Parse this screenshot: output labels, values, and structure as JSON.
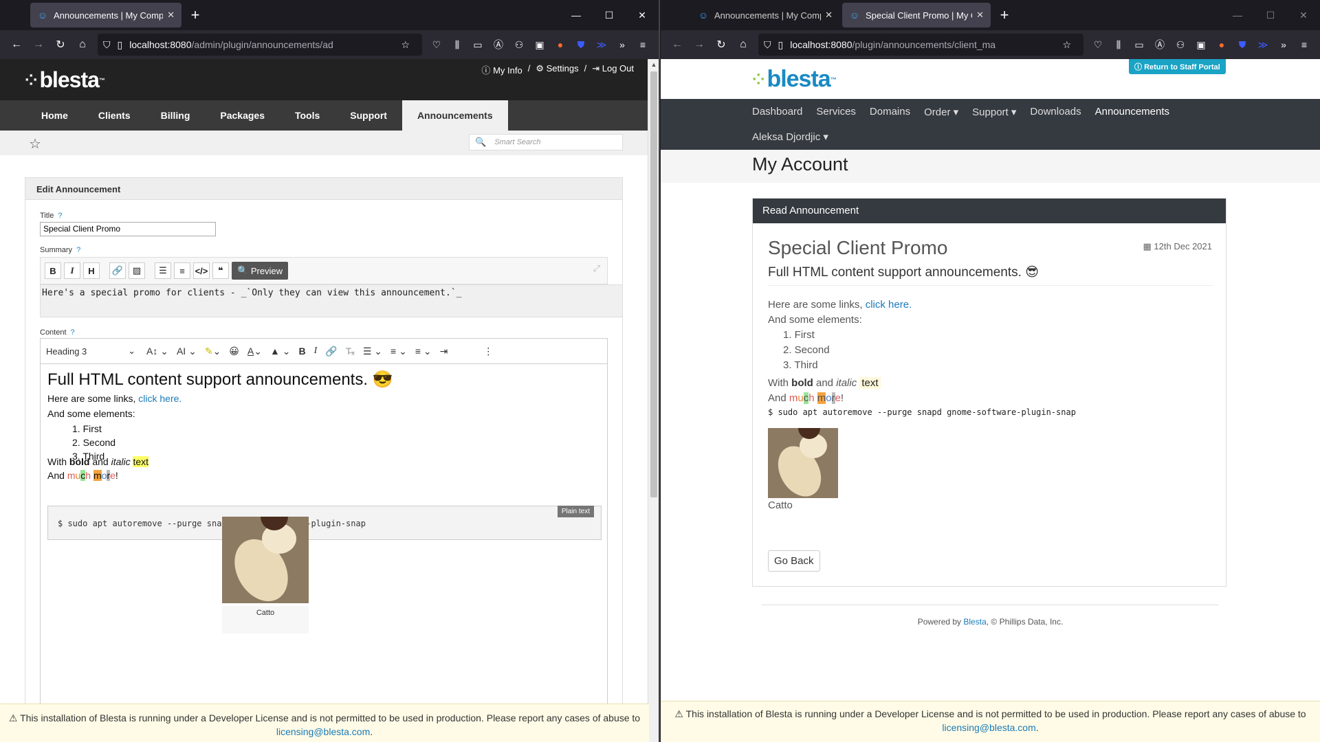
{
  "left": {
    "tabs": [
      {
        "title": "Announcements | My Company",
        "active": true
      }
    ],
    "url": {
      "host": "localhost:8080",
      "path": "/admin/plugin/announcements/ad"
    },
    "header_links": [
      "My Info",
      "Settings",
      "Log Out"
    ],
    "logo": "blesta",
    "nav": [
      "Home",
      "Clients",
      "Billing",
      "Packages",
      "Tools",
      "Support",
      "Announcements"
    ],
    "nav_active": "Announcements",
    "smart_search_placeholder": "Smart Search",
    "panel_title": "Edit Announcement",
    "title_label": "Title",
    "title_value": "Special Client Promo",
    "summary_label": "Summary",
    "preview_label": "Preview",
    "summary_value": "Here's a special promo for clients - _`Only they can view this announcement.`_",
    "content_label": "Content",
    "heading_select": "Heading 3",
    "content": {
      "h3": "Full HTML content support announcements. 😎",
      "links_text": "Here are some links, ",
      "links_link": "click here.",
      "elements_text": "And some elements:",
      "list": [
        "First",
        "Second",
        "Third"
      ],
      "with": "With ",
      "bold": "bold",
      "and": " and ",
      "italic": "italic",
      "text": "text",
      "and2": "And ",
      "much_more": "much more",
      "bang": "!",
      "code": "$ sudo apt autoremove --purge snapd gnome-software-plugin-snap",
      "code_tag": "Plain text",
      "caption": "Catto"
    },
    "dev_notice": "This installation of Blesta is running under a Developer License and is not permitted to be used in production. Please report any cases of abuse to",
    "dev_email": "licensing@blesta.com"
  },
  "right": {
    "tabs": [
      {
        "title": "Announcements | My Company",
        "active": false
      },
      {
        "title": "Special Client Promo | My Comp",
        "active": true
      }
    ],
    "url": {
      "host": "localhost:8080",
      "path": "/plugin/announcements/client_ma"
    },
    "return_btn": "Return to Staff Portal",
    "logo": "blesta",
    "nav": [
      "Dashboard",
      "Services",
      "Domains",
      "Order ▾",
      "Support ▾",
      "Downloads",
      "Announcements"
    ],
    "nav_active": "Announcements",
    "user": "Aleksa Djordjic ▾",
    "page_title": "My Account",
    "card_title": "Read Announcement",
    "ann_title": "Special Client Promo",
    "ann_date": "12th Dec 2021",
    "ann_sub": "Full HTML content support announcements. 😎",
    "links_text": "Here are some links, ",
    "links_link": "click here.",
    "elements_text": "And some elements:",
    "list": [
      "1. First",
      "2. Second",
      "3. Third"
    ],
    "with": "With ",
    "bold": "bold",
    "and": " and ",
    "italic": "italic",
    "text": "text",
    "and2": "And ",
    "code": "$ sudo apt autoremove --purge snapd gnome-software-plugin-snap",
    "caption": "Catto",
    "go_back": "Go Back",
    "footer_pre": "Powered by ",
    "footer_link": "Blesta",
    "footer_post": ", © Phillips Data, Inc.",
    "dev_notice": "This installation of Blesta is running under a Developer License and is not permitted to be used in production. Please report any cases of abuse to",
    "dev_email": "licensing@blesta.com"
  },
  "colors": {
    "accent": "#1a7ab8",
    "logo_green": "#8cc63f",
    "logo_blue": "#1a8ac4"
  }
}
